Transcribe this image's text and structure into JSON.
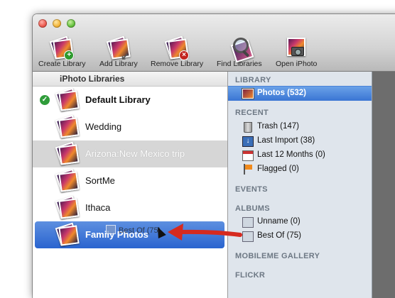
{
  "toolbar": {
    "create_library": "Create Library",
    "add_library": "Add Library",
    "remove_library": "Remove Library",
    "find_libraries": "Find Libraries",
    "open_iphoto": "Open iPhoto"
  },
  "libraries": {
    "header": "iPhoto Libraries",
    "items": [
      {
        "name": "Default Library"
      },
      {
        "name": "Wedding"
      },
      {
        "name": "Arizona:New Mexico trip"
      },
      {
        "name": "SortMe"
      },
      {
        "name": "Ithaca"
      },
      {
        "name": "Family Photos"
      }
    ]
  },
  "source_list": {
    "library_header": "LIBRARY",
    "photos": "Photos (532)",
    "recent_header": "RECENT",
    "trash": "Trash (147)",
    "last_import": "Last Import (38)",
    "last_12_months": "Last 12 Months (0)",
    "flagged": "Flagged (0)",
    "events_header": "EVENTS",
    "albums_header": "ALBUMS",
    "unname": "Unname (0)",
    "best_of": "Best Of (75)",
    "mobileme_header": "MOBILEME GALLERY",
    "flickr_header": "FLICKR"
  },
  "drag": {
    "label": "Best Of (75)"
  }
}
